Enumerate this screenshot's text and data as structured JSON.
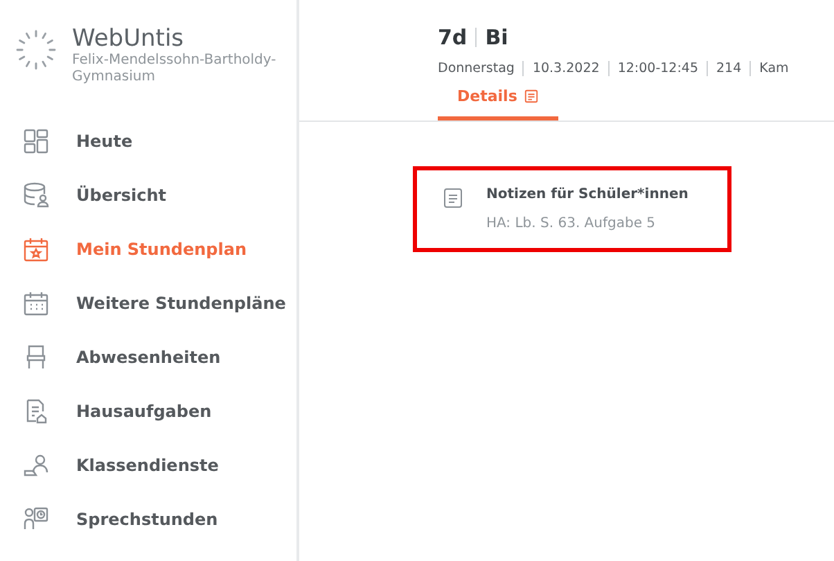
{
  "app": {
    "name": "WebUntis",
    "school": "Felix-Mendelssohn-Bartholdy-Gymnasium"
  },
  "sidebar": {
    "items": [
      {
        "label": "Heute",
        "selected": false
      },
      {
        "label": "Übersicht",
        "selected": false
      },
      {
        "label": "Mein Stundenplan",
        "selected": true
      },
      {
        "label": "Weitere Stundenpläne",
        "selected": false
      },
      {
        "label": "Abwesenheiten",
        "selected": false
      },
      {
        "label": "Hausaufgaben",
        "selected": false
      },
      {
        "label": "Klassendienste",
        "selected": false
      },
      {
        "label": "Sprechstunden",
        "selected": false
      }
    ]
  },
  "lesson": {
    "class": "7d",
    "subject": "Bi",
    "meta": [
      "Donnerstag",
      "10.3.2022",
      "12:00-12:45",
      "214",
      "Kam"
    ]
  },
  "tabs": [
    {
      "label": "Details",
      "selected": true
    }
  ],
  "note": {
    "title": "Notizen für Schüler*innen",
    "text": "HA: Lb. S. 63. Aufgabe 5",
    "highlighted": true
  }
}
